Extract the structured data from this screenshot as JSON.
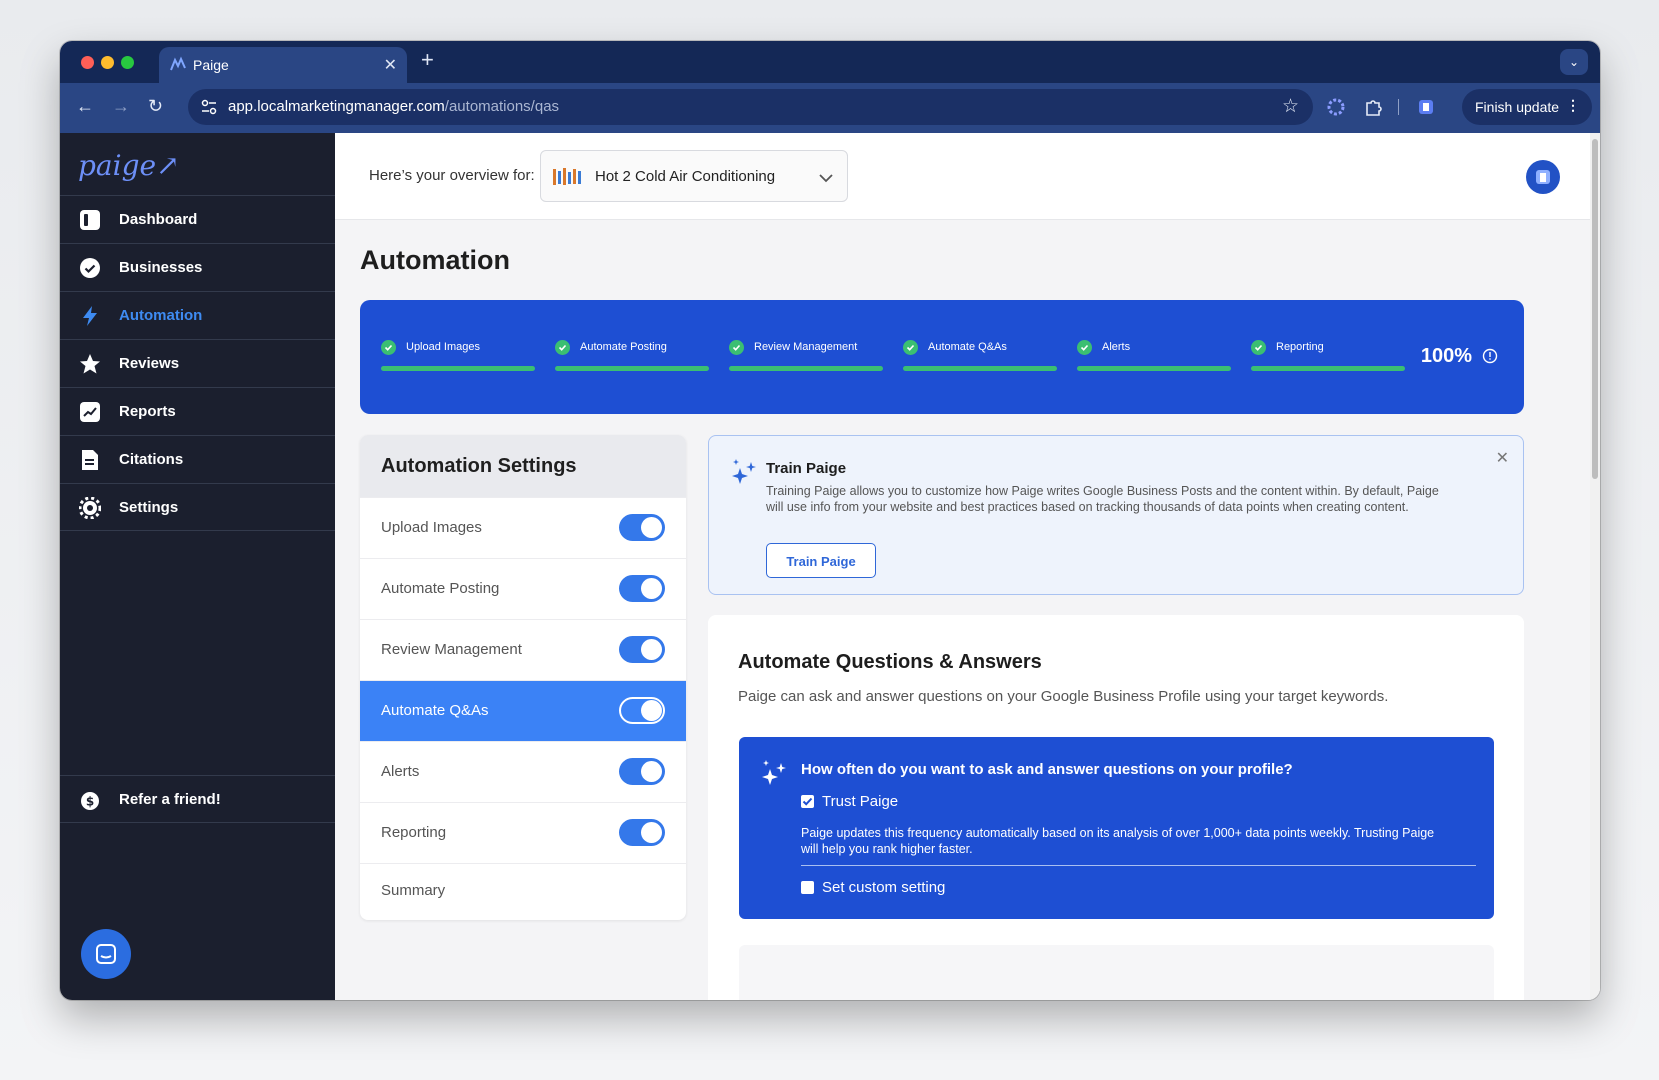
{
  "browser": {
    "tab_title": "Paige",
    "url_host": "app.localmarketingmanager.com",
    "url_path": "/automations/qas",
    "finish_update": "Finish update"
  },
  "sidebar": {
    "logo": "paige",
    "items": [
      {
        "label": "Dashboard",
        "icon": "dashboard-icon"
      },
      {
        "label": "Businesses",
        "icon": "badge-check-icon"
      },
      {
        "label": "Automation",
        "icon": "lightning-icon"
      },
      {
        "label": "Reviews",
        "icon": "star-icon"
      },
      {
        "label": "Reports",
        "icon": "trend-icon"
      },
      {
        "label": "Citations",
        "icon": "document-icon"
      },
      {
        "label": "Settings",
        "icon": "gear-icon"
      }
    ],
    "refer": "Refer a friend!"
  },
  "topbar": {
    "overview_label": "Here’s your overview for:",
    "business_name": "Hot 2 Cold Air Conditioning"
  },
  "page_title": "Automation",
  "progress": {
    "steps": [
      "Upload Images",
      "Automate Posting",
      "Review Management",
      "Automate Q&As",
      "Alerts",
      "Reporting"
    ],
    "percent": "100%",
    "complete_fraction": 1.0
  },
  "settings": {
    "title": "Automation Settings",
    "rows": [
      {
        "label": "Upload Images",
        "on": true
      },
      {
        "label": "Automate Posting",
        "on": true
      },
      {
        "label": "Review Management",
        "on": true
      },
      {
        "label": "Automate Q&As",
        "on": true
      },
      {
        "label": "Alerts",
        "on": true
      },
      {
        "label": "Reporting",
        "on": true
      }
    ],
    "summary": "Summary"
  },
  "train": {
    "title": "Train Paige",
    "text": "Training Paige allows you to customize how Paige writes Google Business Posts and the content within. By default, Paige will use info from your website and best practices based on tracking thousands of data points when creating content.",
    "button": "Train Paige"
  },
  "qa": {
    "title": "Automate Questions & Answers",
    "description": "Paige can ask and answer questions on your Google Business Profile using your target keywords.",
    "question": "How often do you want to ask and answer questions on your profile?",
    "trust_label": "Trust Paige",
    "trust_checked": true,
    "trust_desc": "Paige updates this frequency automatically based on its analysis of over 1,000+ data points weekly. Trusting Paige will help you rank higher faster.",
    "custom_label": "Set custom setting",
    "custom_checked": false
  },
  "colors": {
    "brand_blue": "#1e4fd3",
    "sidebar_bg": "#1b1f2e",
    "active_blue": "#3b82f6",
    "success_green": "#3bbf72"
  }
}
